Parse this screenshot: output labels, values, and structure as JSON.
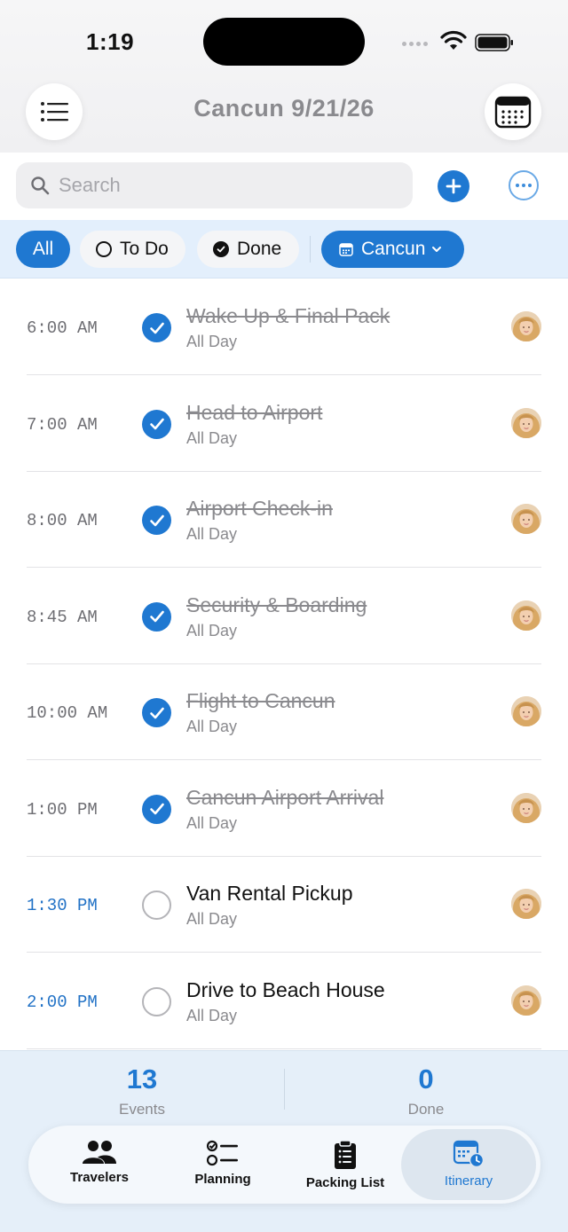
{
  "status_bar": {
    "time": "1:19"
  },
  "header": {
    "title": "Cancun 9/21/26",
    "menu_icon": "list-icon",
    "calendar_icon": "calendar-grid-icon"
  },
  "search": {
    "placeholder": "Search",
    "value": ""
  },
  "filters": {
    "all": "All",
    "todo": "To Do",
    "done": "Done",
    "location": "Cancun",
    "selected": "All"
  },
  "events": [
    {
      "time": "6:00 AM",
      "title": "Wake Up & Final Pack",
      "subtitle": "All Day",
      "done": true
    },
    {
      "time": "7:00 AM",
      "title": "Head to Airport",
      "subtitle": "All Day",
      "done": true
    },
    {
      "time": "8:00 AM",
      "title": "Airport Check-in",
      "subtitle": "All Day",
      "done": true
    },
    {
      "time": "8:45 AM",
      "title": "Security & Boarding",
      "subtitle": "All Day",
      "done": true
    },
    {
      "time": "10:00 AM",
      "title": "Flight to Cancun",
      "subtitle": "All Day",
      "done": true
    },
    {
      "time": "1:00 PM",
      "title": "Cancun Airport Arrival",
      "subtitle": "All Day",
      "done": true
    },
    {
      "time": "1:30 PM",
      "title": "Van Rental Pickup",
      "subtitle": "All Day",
      "done": false
    },
    {
      "time": "2:00 PM",
      "title": "Drive to Beach House",
      "subtitle": "All Day",
      "done": false
    }
  ],
  "stats": {
    "events_count": "13",
    "events_label": "Events",
    "done_count": "0",
    "done_label": "Done"
  },
  "tabs": [
    {
      "label": "Travelers",
      "icon": "people-icon"
    },
    {
      "label": "Planning",
      "icon": "checklist-icon"
    },
    {
      "label": "Packing List",
      "icon": "clipboard-icon"
    },
    {
      "label": "Itinerary",
      "icon": "calendar-clock-icon",
      "selected": true
    }
  ],
  "colors": {
    "accent": "#1f78d1",
    "muted": "#8a8a8e",
    "filter_bar": "#e3effc"
  }
}
